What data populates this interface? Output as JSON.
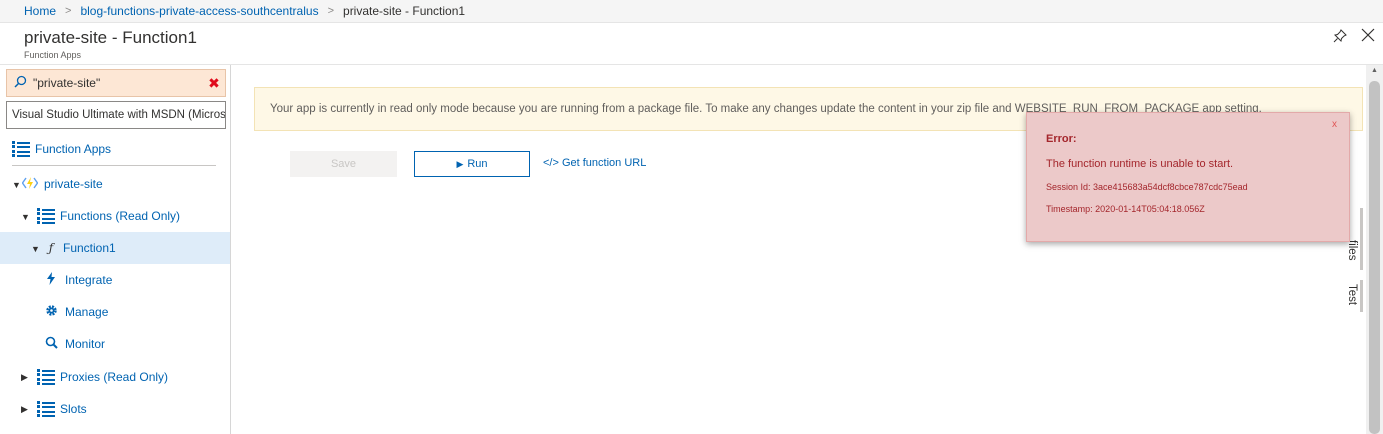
{
  "breadcrumb": {
    "items": [
      "Home",
      "blog-functions-private-access-southcentralus",
      "private-site - Function1"
    ]
  },
  "header": {
    "title": "private-site - Function1",
    "subtitle": "Function Apps"
  },
  "sidebar": {
    "search_value": "\"private-site\"",
    "subscription": "Visual Studio Ultimate with MSDN (Microsc",
    "function_apps_label": "Function Apps",
    "tree": [
      {
        "label": "private-site"
      },
      {
        "label": "Functions (Read Only)"
      },
      {
        "label": "Function1"
      },
      {
        "label": "Integrate"
      },
      {
        "label": "Manage"
      },
      {
        "label": "Monitor"
      },
      {
        "label": "Proxies (Read Only)"
      },
      {
        "label": "Slots"
      }
    ]
  },
  "main": {
    "banner": "Your app is currently in read only mode because you are running from a package file. To make any changes update the content in your zip file and WEBSITE_RUN_FROM_PACKAGE app setting.",
    "save_label": "Save",
    "run_label": "Run",
    "get_url_label": "</> Get function URL",
    "side_tabs": [
      "files",
      "Test"
    ]
  },
  "error": {
    "title": "Error:",
    "close": "x",
    "message": "The function runtime is unable to start.",
    "session": "Session Id: 3ace415683a54dcf8cbce787cdc75ead",
    "timestamp": "Timestamp: 2020-01-14T05:04:18.056Z"
  },
  "colors": {
    "accent": "#0063b1",
    "error_bg": "#ecc9c9",
    "error_text": "#a4262c",
    "banner_bg": "#fef8e6",
    "search_bg": "#fde7d5"
  }
}
